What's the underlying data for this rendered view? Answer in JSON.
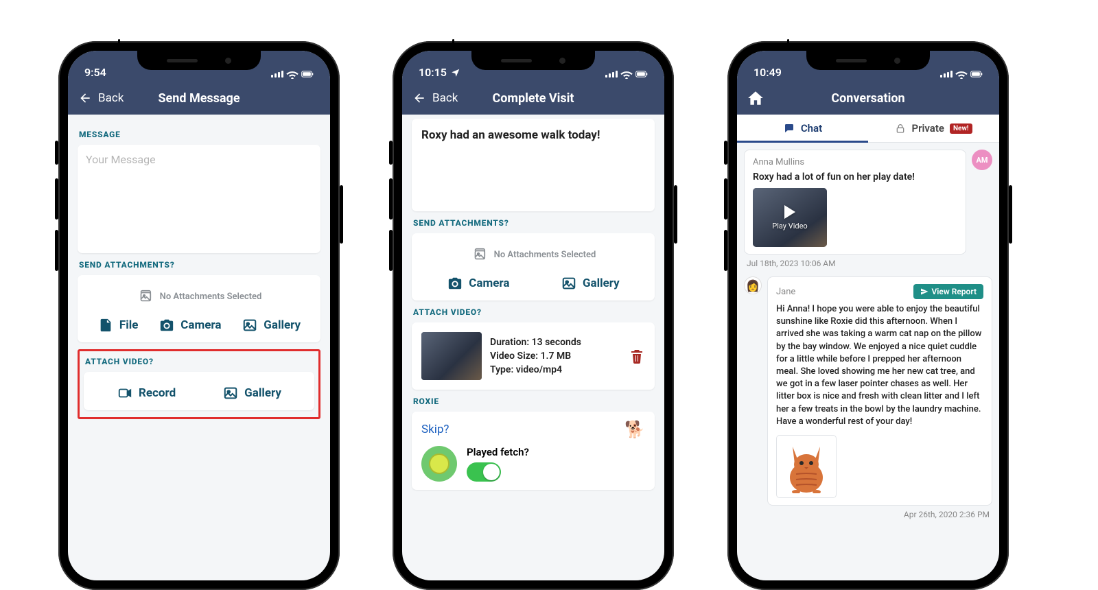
{
  "phone1": {
    "status_time": "9:54",
    "nav": {
      "back": "Back",
      "title": "Send Message"
    },
    "message_label": "MESSAGE",
    "message_placeholder": "Your Message",
    "attach_label": "SEND ATTACHMENTS?",
    "no_attach": "No Attachments Selected",
    "buttons": {
      "file": "File",
      "camera": "Camera",
      "gallery": "Gallery"
    },
    "video_label": "ATTACH VIDEO?",
    "video_buttons": {
      "record": "Record",
      "gallery": "Gallery"
    }
  },
  "phone2": {
    "status_time": "10:15",
    "nav": {
      "back": "Back",
      "title": "Complete Visit"
    },
    "visit_message": "Roxy had an awesome walk today!",
    "attach_label": "SEND ATTACHMENTS?",
    "no_attach": "No Attachments Selected",
    "buttons": {
      "camera": "Camera",
      "gallery": "Gallery"
    },
    "video_label": "ATTACH VIDEO?",
    "video": {
      "duration": "Duration: 13 seconds",
      "size": "Video Size: 1.7 MB",
      "type": "Type: video/mp4"
    },
    "pet_label": "ROXIE",
    "skip": "Skip?",
    "played_fetch": "Played fetch?"
  },
  "phone3": {
    "status_time": "10:49",
    "nav": {
      "title": "Conversation"
    },
    "tabs": {
      "chat": "Chat",
      "private": "Private",
      "new_badge": "New!"
    },
    "msg1": {
      "sender": "Anna Mullins",
      "avatar_initials": "AM",
      "text": "Roxy had a lot of fun on her play date!",
      "play_video": "Play Video",
      "time": "Jul 18th, 2023 10:06 AM"
    },
    "msg2": {
      "sender": "Jane",
      "view_report": "View Report",
      "text": "Hi Anna! I hope you were able to enjoy the beautiful sunshine like Roxie did this afternoon. When I arrived she was taking a warm cat nap on the pillow by the bay window. We enjoyed a nice quiet cuddle for a little while before I prepped her afternoon meal. She loved showing me her new cat tree, and we got in a few laser pointer chases as well. Her litter box is nice and fresh with clean litter and I left her a few treats in the bowl by the laundry machine. Have a wonderful rest of your day!",
      "time": "Apr 26th, 2020 2:36 PM"
    }
  }
}
